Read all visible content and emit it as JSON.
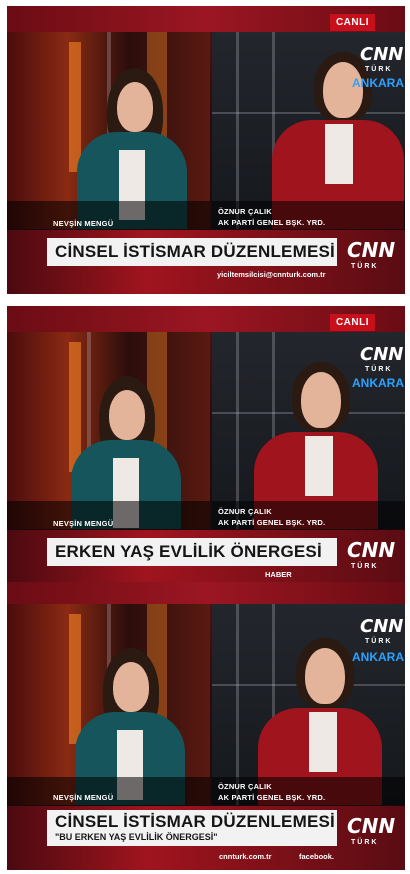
{
  "frames": [
    {
      "live_badge": "CANLI",
      "left_name": "NEVŞİN MENGÜ",
      "right_name": "ÖZNUR ÇALIK",
      "right_title": "AK PARTİ GENEL BŞK. YRD.",
      "headline": "CİNSEL İSTİSMAR DÜZENLEMESİ",
      "subline": "",
      "ticker_left": "",
      "ticker_right": "yiciltemsilcisi@cnnturk.com.tr",
      "city": "ANKARA"
    },
    {
      "live_badge": "CANLI",
      "left_name": "NEVŞİN MENGÜ",
      "right_name": "ÖZNUR ÇALIK",
      "right_title": "AK PARTİ GENEL BŞK. YRD.",
      "headline": "ERKEN YAŞ EVLİLİK ÖNERGESİ",
      "subline": "",
      "ticker_left": "",
      "ticker_right": "HABER",
      "city": "ANKARA"
    },
    {
      "live_badge": "",
      "left_name": "NEVŞİN MENGÜ",
      "right_name": "ÖZNUR ÇALIK",
      "right_title": "AK PARTİ GENEL BŞK. YRD.",
      "headline": "CİNSEL İSTİSMAR DÜZENLEMESİ",
      "subline": "\"BU ERKEN YAŞ EVLİLİK ÖNERGESİ\"",
      "ticker_left": "cnnturk.com.tr",
      "ticker_right": "facebook.",
      "city": "ANKARA"
    }
  ],
  "logo": {
    "cnn": "CNN",
    "turk": "TÜRK"
  },
  "colors": {
    "brand_red": "#c8101c",
    "city_blue": "#2aa3ff",
    "left_jacket": "#16555c",
    "right_jacket": "#a0141e"
  }
}
